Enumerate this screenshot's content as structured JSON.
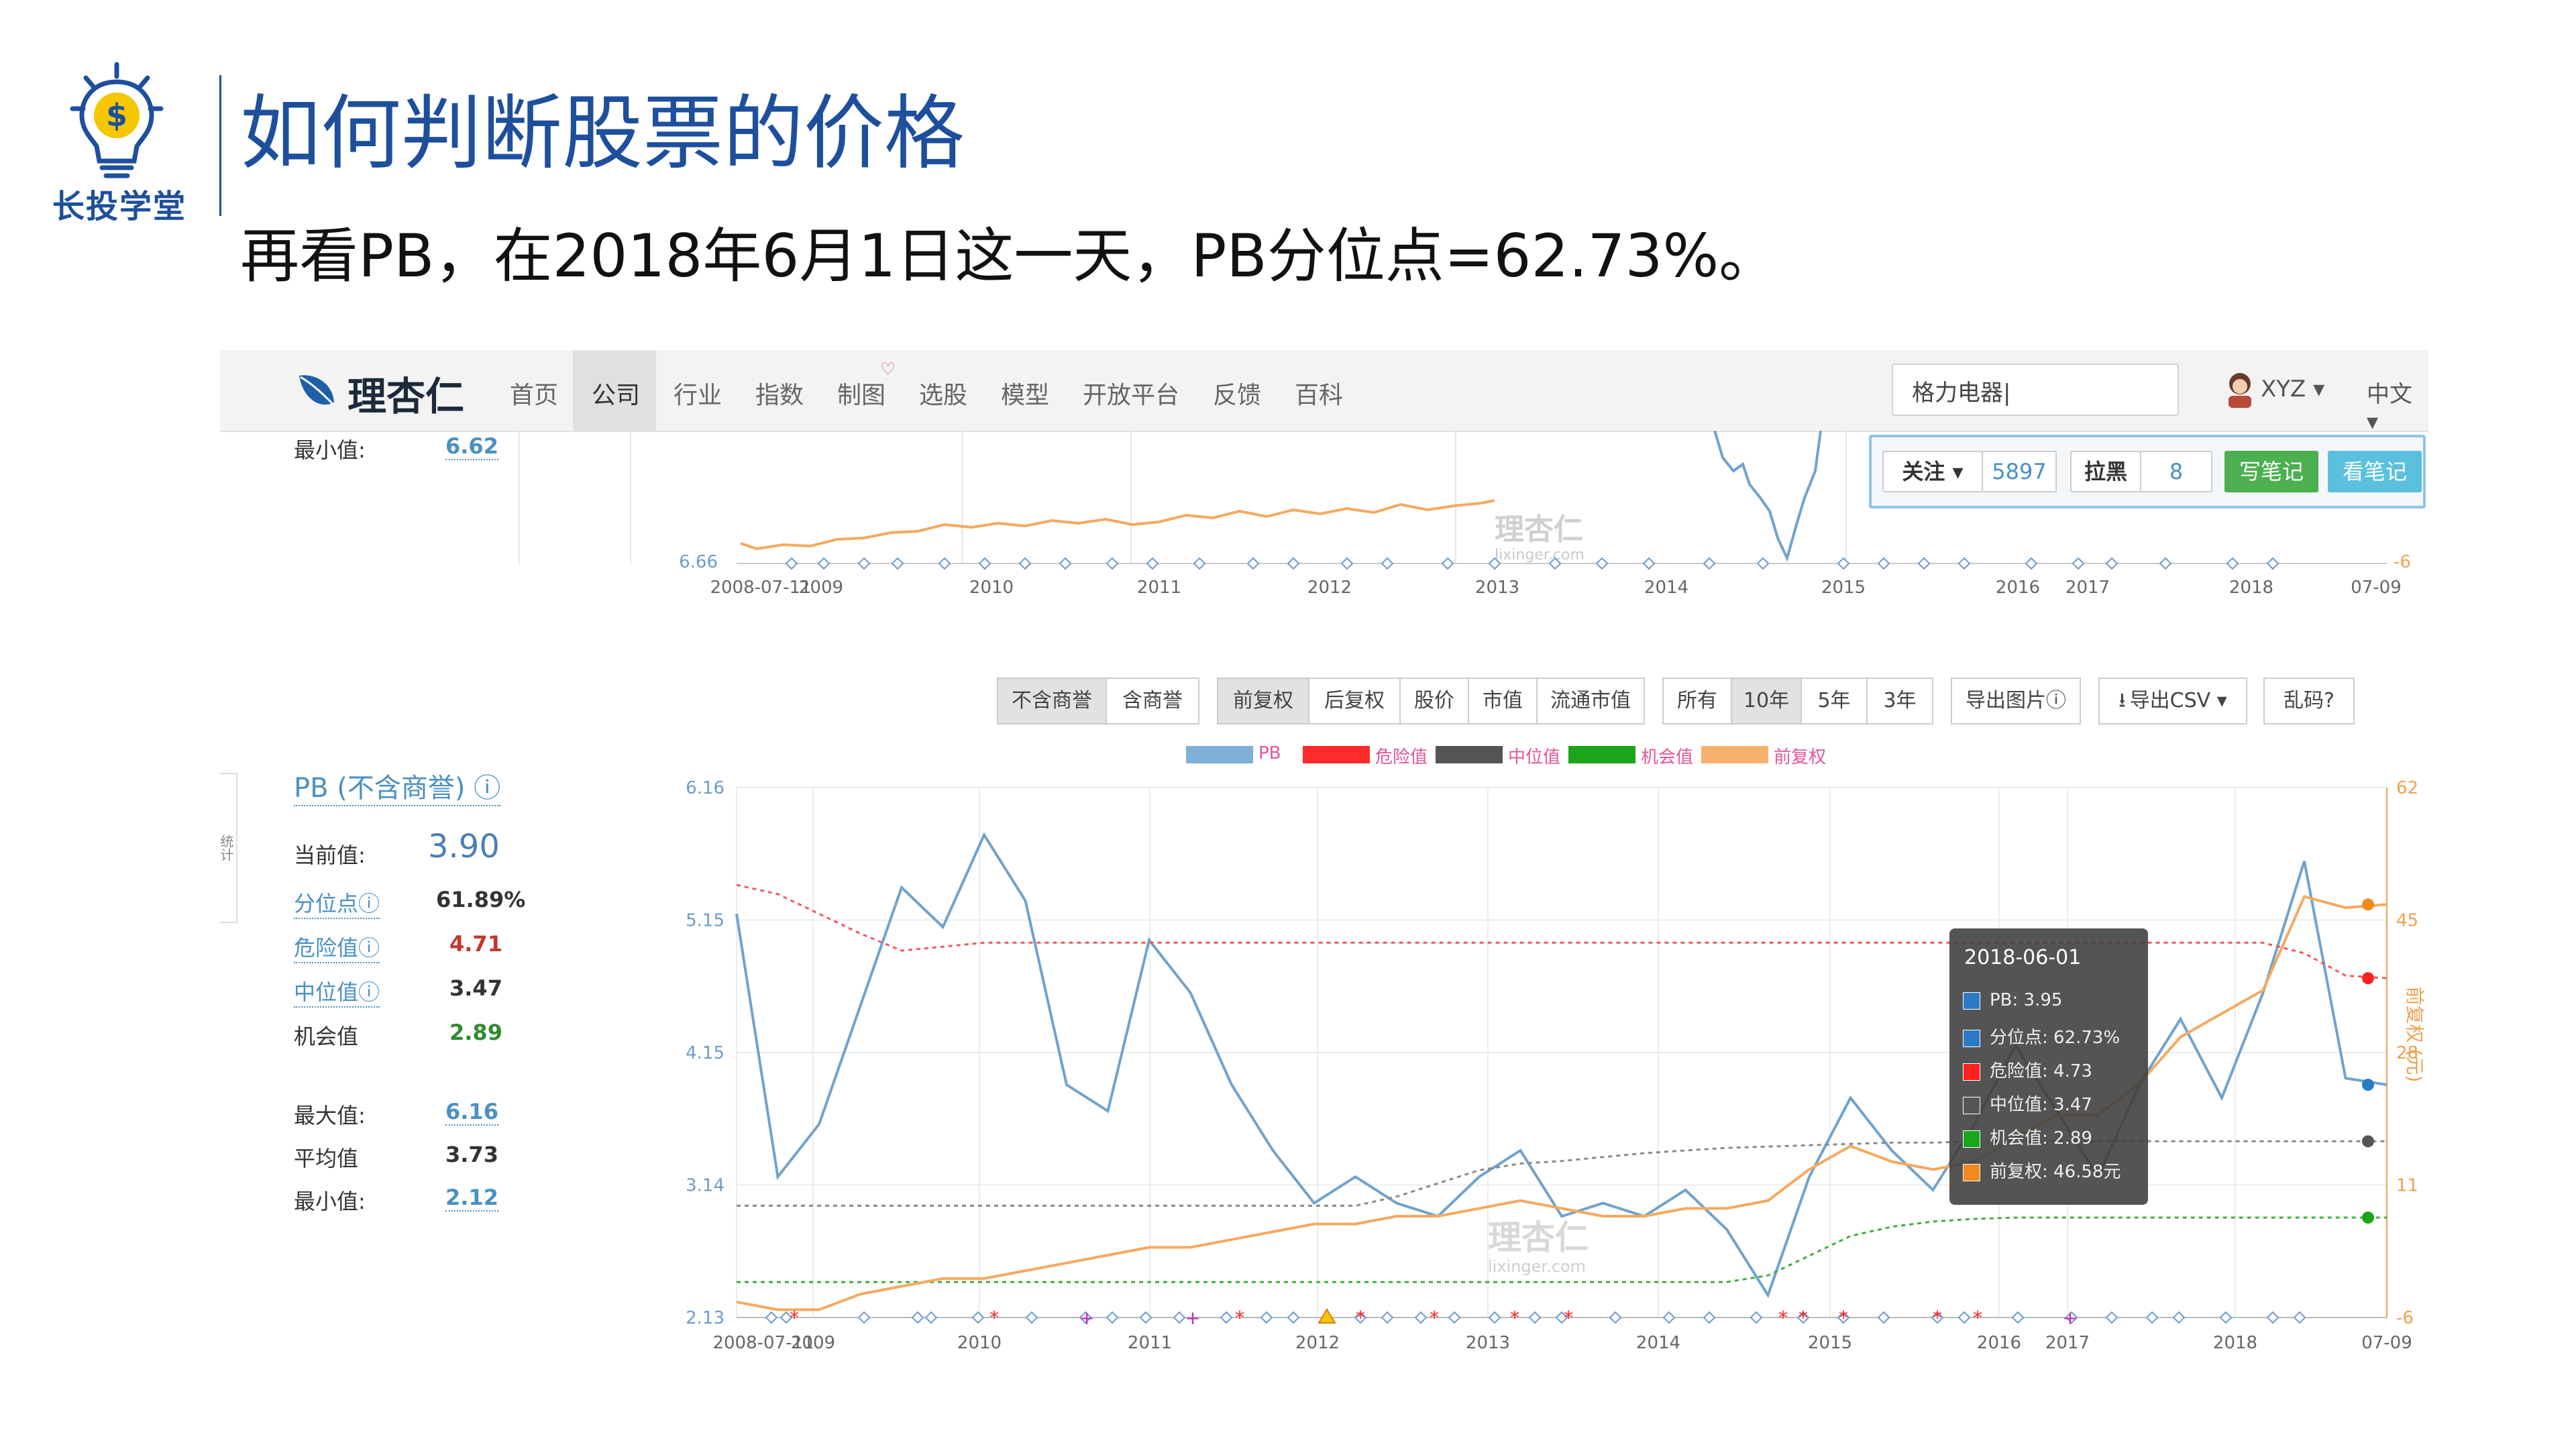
{
  "slide": {
    "brand": "长投学堂",
    "title": "如何判断股票的价格",
    "subtitle": "再看PB，在2018年6月1日这一天，PB分位点=62.73%。"
  },
  "nav": {
    "brand": "理杏仁",
    "items": [
      "首页",
      "公司",
      "行业",
      "指数",
      "制图",
      "选股",
      "模型",
      "开放平台",
      "反馈",
      "百科"
    ],
    "active": "公司",
    "search_value": "格力电器|",
    "user": "XYZ ▾",
    "lang": "中文 ▾"
  },
  "follow": {
    "follow_label": "关注 ▾",
    "follow_count": "5897",
    "block_label": "拉黑",
    "block_count": "8",
    "write_note": "写笔记",
    "view_note": "看笔记"
  },
  "upper_chart": {
    "min_label": "最小值:",
    "min_value": "6.62",
    "ytick_left": "6.66",
    "ytick_right": "-6",
    "xticks": [
      "2008-07-11",
      "2009",
      "2010",
      "2011",
      "2012",
      "2013",
      "2014",
      "2015",
      "2016",
      "2017",
      "2018",
      "07-09"
    ],
    "watermark": "理杏仁",
    "watermark_url": "lixinger.com"
  },
  "stats": {
    "title": "PB (不含商誉) ⓘ",
    "side_tab": "统计",
    "current_label": "当前值:",
    "current_value": "3.90",
    "rows": [
      {
        "label": "分位点ⓘ",
        "value": "61.89%",
        "color": "#333"
      },
      {
        "label": "危险值ⓘ",
        "value": "4.71",
        "color": "#c0392b"
      },
      {
        "label": "中位值ⓘ",
        "value": "3.47",
        "color": "#333"
      },
      {
        "label": "机会值",
        "value": "2.89",
        "color": "#2e8b2e"
      }
    ],
    "rows2": [
      {
        "label": "最大值:",
        "value": "6.16"
      },
      {
        "label": "平均值",
        "value": "3.73"
      },
      {
        "label": "最小值:",
        "value": "2.12"
      }
    ]
  },
  "buttons": {
    "group1": [
      "不含商誉",
      "含商誉"
    ],
    "group2": [
      "前复权",
      "后复权",
      "股价",
      "市值",
      "流通市值"
    ],
    "group3": [
      "所有",
      "10年",
      "5年",
      "3年"
    ],
    "export_img": "导出图片ⓘ",
    "export_csv": "导出CSV ▾",
    "garbled": "乱码?"
  },
  "legend": [
    {
      "name": "PB",
      "color": "#7fb0d8",
      "text_color": "#e0559a"
    },
    {
      "name": "危险值",
      "color": "#ff2a2a",
      "text_color": "#e0559a"
    },
    {
      "name": "中位值",
      "color": "#555555",
      "text_color": "#e0559a"
    },
    {
      "name": "机会值",
      "color": "#1aa51a",
      "text_color": "#e0559a"
    },
    {
      "name": "前复权",
      "color": "#f5b16d",
      "text_color": "#e0559a"
    }
  ],
  "right_axis_label": "前复权 (元)",
  "tooltip": {
    "date": "2018-06-01",
    "rows": [
      {
        "color": "#2a7bc4",
        "text": "PB: 3.95"
      },
      {
        "color": "#2a7bc4",
        "text": "分位点: 62.73%"
      },
      {
        "color": "#ff2020",
        "text": "危险值: 4.73"
      },
      {
        "color": "#555555",
        "text": "中位值: 3.47"
      },
      {
        "color": "#1aa51a",
        "text": "机会值: 2.89"
      },
      {
        "color": "#f08a1e",
        "text": "前复权: 46.58元"
      }
    ]
  },
  "chart_data": {
    "type": "line",
    "title": "PB (不含商誉)",
    "x": [
      "2008-07-11",
      "2008-12",
      "2009-03",
      "2009-06",
      "2009-09",
      "2009-12",
      "2010-03",
      "2010-06",
      "2010-09",
      "2010-12",
      "2011-03",
      "2011-06",
      "2011-09",
      "2011-12",
      "2012-03",
      "2012-06",
      "2012-09",
      "2012-12",
      "2013-03",
      "2013-06",
      "2013-09",
      "2013-12",
      "2014-03",
      "2014-06",
      "2014-09",
      "2014-12",
      "2015-03",
      "2015-06",
      "2015-09",
      "2015-12",
      "2016-03",
      "2016-06",
      "2016-09",
      "2016-12",
      "2017-03",
      "2017-06",
      "2017-09",
      "2017-12",
      "2018-03",
      "2018-06",
      "2018-07-09"
    ],
    "series": [
      {
        "name": "PB",
        "axis": "left",
        "values": [
          5.2,
          3.2,
          3.6,
          4.5,
          5.4,
          5.1,
          5.8,
          5.3,
          3.9,
          3.7,
          5.0,
          4.6,
          3.9,
          3.4,
          3.0,
          3.2,
          3.0,
          2.9,
          3.2,
          3.4,
          2.9,
          3.0,
          2.9,
          3.1,
          2.8,
          2.3,
          3.2,
          3.8,
          3.4,
          3.1,
          3.6,
          4.2,
          3.7,
          3.2,
          3.9,
          4.4,
          3.8,
          4.6,
          5.6,
          3.95,
          3.9
        ]
      },
      {
        "name": "危险值",
        "axis": "left",
        "values": [
          5.42,
          5.35,
          5.2,
          5.05,
          4.92,
          4.95,
          4.98,
          4.98,
          4.98,
          4.98,
          4.98,
          4.98,
          4.98,
          4.98,
          4.98,
          4.98,
          4.98,
          4.98,
          4.98,
          4.98,
          4.98,
          4.98,
          4.98,
          4.98,
          4.98,
          4.98,
          4.98,
          4.98,
          4.98,
          4.98,
          4.98,
          4.98,
          4.98,
          4.98,
          4.98,
          4.98,
          4.98,
          4.98,
          4.9,
          4.73,
          4.71
        ]
      },
      {
        "name": "中位值",
        "axis": "left",
        "values": [
          2.98,
          2.98,
          2.98,
          2.98,
          2.98,
          2.98,
          2.98,
          2.98,
          2.98,
          2.98,
          2.98,
          2.98,
          2.98,
          2.98,
          2.98,
          2.98,
          3.05,
          3.15,
          3.25,
          3.3,
          3.32,
          3.35,
          3.38,
          3.4,
          3.42,
          3.43,
          3.44,
          3.45,
          3.46,
          3.46,
          3.47,
          3.47,
          3.47,
          3.47,
          3.47,
          3.47,
          3.47,
          3.47,
          3.47,
          3.47,
          3.47
        ]
      },
      {
        "name": "机会值",
        "axis": "left",
        "values": [
          2.4,
          2.4,
          2.4,
          2.4,
          2.4,
          2.4,
          2.4,
          2.4,
          2.4,
          2.4,
          2.4,
          2.4,
          2.4,
          2.4,
          2.4,
          2.4,
          2.4,
          2.4,
          2.4,
          2.4,
          2.4,
          2.4,
          2.4,
          2.4,
          2.4,
          2.45,
          2.6,
          2.75,
          2.82,
          2.86,
          2.88,
          2.89,
          2.89,
          2.89,
          2.89,
          2.89,
          2.89,
          2.89,
          2.89,
          2.89,
          2.89
        ]
      },
      {
        "name": "前复权",
        "axis": "right",
        "values": [
          -4,
          -5,
          -5,
          -3,
          -2,
          -1,
          -1,
          0,
          1,
          2,
          3,
          3,
          4,
          5,
          6,
          6,
          7,
          7,
          8,
          9,
          8,
          7,
          7,
          8,
          8,
          9,
          13,
          16,
          14,
          13,
          14,
          17,
          20,
          20,
          24,
          30,
          33,
          36,
          48,
          46.58,
          47
        ]
      }
    ],
    "ylim": [
      2.13,
      6.16
    ],
    "yticks": [
      "6.16",
      "5.15",
      "4.15",
      "3.14",
      "2.13"
    ],
    "y2lim": [
      -6,
      62
    ],
    "y2ticks": [
      "62",
      "45",
      "28",
      "11",
      "-6"
    ],
    "xticks": [
      "2008-07-11",
      "2009",
      "2010",
      "2011",
      "2012",
      "2013",
      "2014",
      "2015",
      "2016",
      "2017",
      "2018",
      "07-09"
    ],
    "ylabel": "",
    "y2label": "前复权 (元)",
    "grid": true,
    "legend_position": "top"
  }
}
